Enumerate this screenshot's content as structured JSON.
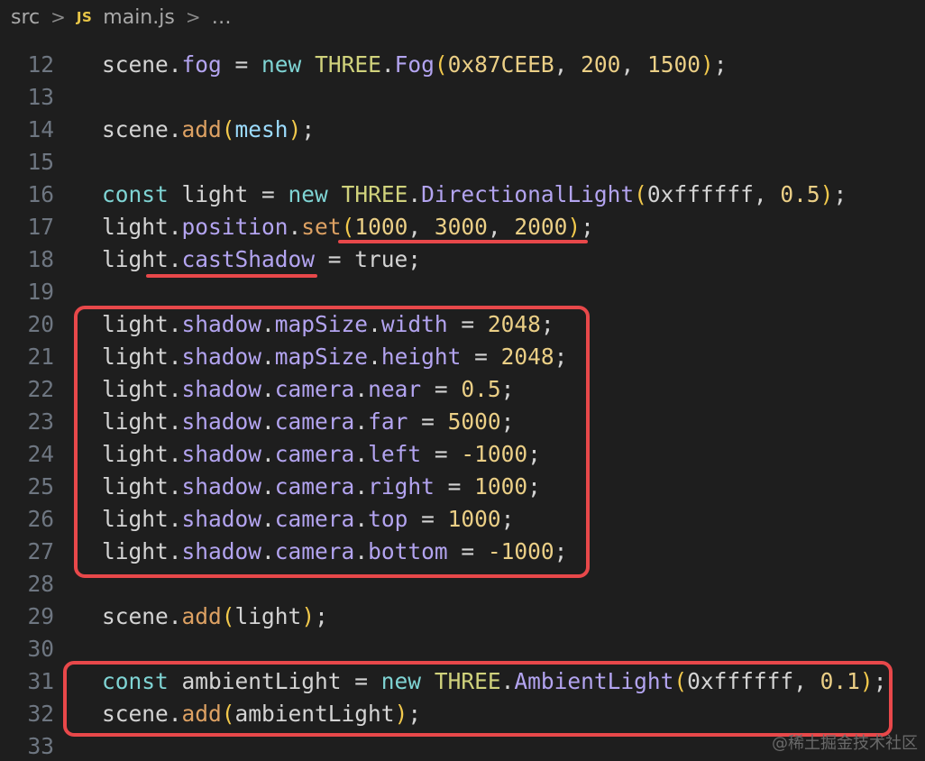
{
  "breadcrumb": {
    "folder": "src",
    "separator": ">",
    "file_icon_label": "JS",
    "file": "main.js",
    "more": "…"
  },
  "code": {
    "lines": [
      {
        "number": "12",
        "tokens": [
          {
            "t": "scene.",
            "c": "plain"
          },
          {
            "t": "fog",
            "c": "prop"
          },
          {
            "t": " = ",
            "c": "plain"
          },
          {
            "t": "new",
            "c": "kw"
          },
          {
            "t": " ",
            "c": "plain"
          },
          {
            "t": "THREE",
            "c": "class"
          },
          {
            "t": ".",
            "c": "plain"
          },
          {
            "t": "Fog",
            "c": "ctor"
          },
          {
            "t": "(",
            "c": "paren"
          },
          {
            "t": "0x87CEEB",
            "c": "num"
          },
          {
            "t": ", ",
            "c": "plain"
          },
          {
            "t": "200",
            "c": "num"
          },
          {
            "t": ", ",
            "c": "plain"
          },
          {
            "t": "1500",
            "c": "num"
          },
          {
            "t": ")",
            "c": "paren"
          },
          {
            "t": ";",
            "c": "plain"
          }
        ]
      },
      {
        "number": "13",
        "tokens": []
      },
      {
        "number": "14",
        "tokens": [
          {
            "t": "scene.",
            "c": "plain"
          },
          {
            "t": "add",
            "c": "fn"
          },
          {
            "t": "(",
            "c": "paren"
          },
          {
            "t": "mesh",
            "c": "var"
          },
          {
            "t": ")",
            "c": "paren"
          },
          {
            "t": ";",
            "c": "plain"
          }
        ]
      },
      {
        "number": "15",
        "tokens": []
      },
      {
        "number": "16",
        "tokens": [
          {
            "t": "const",
            "c": "kw"
          },
          {
            "t": " light = ",
            "c": "plain"
          },
          {
            "t": "new",
            "c": "kw"
          },
          {
            "t": " ",
            "c": "plain"
          },
          {
            "t": "THREE",
            "c": "class"
          },
          {
            "t": ".",
            "c": "plain"
          },
          {
            "t": "DirectionalLight",
            "c": "ctor"
          },
          {
            "t": "(",
            "c": "paren"
          },
          {
            "t": "0xffffff",
            "c": "plain"
          },
          {
            "t": ", ",
            "c": "plain"
          },
          {
            "t": "0.5",
            "c": "num"
          },
          {
            "t": ")",
            "c": "paren"
          },
          {
            "t": ";",
            "c": "plain"
          }
        ]
      },
      {
        "number": "17",
        "tokens": [
          {
            "t": "light.",
            "c": "plain"
          },
          {
            "t": "position",
            "c": "prop"
          },
          {
            "t": ".",
            "c": "plain"
          },
          {
            "t": "set",
            "c": "fn"
          },
          {
            "t": "(",
            "c": "paren"
          },
          {
            "t": "1000",
            "c": "num"
          },
          {
            "t": ", ",
            "c": "plain"
          },
          {
            "t": "3000",
            "c": "num"
          },
          {
            "t": ", ",
            "c": "plain"
          },
          {
            "t": "2000",
            "c": "num"
          },
          {
            "t": ")",
            "c": "paren"
          },
          {
            "t": ";",
            "c": "plain"
          }
        ]
      },
      {
        "number": "18",
        "tokens": [
          {
            "t": "light.",
            "c": "plain"
          },
          {
            "t": "castShadow",
            "c": "prop"
          },
          {
            "t": " = true;",
            "c": "plain"
          }
        ]
      },
      {
        "number": "19",
        "tokens": []
      },
      {
        "number": "20",
        "tokens": [
          {
            "t": "light.",
            "c": "plain"
          },
          {
            "t": "shadow",
            "c": "prop"
          },
          {
            "t": ".",
            "c": "plain"
          },
          {
            "t": "mapSize",
            "c": "prop"
          },
          {
            "t": ".",
            "c": "plain"
          },
          {
            "t": "width",
            "c": "prop"
          },
          {
            "t": " = ",
            "c": "plain"
          },
          {
            "t": "2048",
            "c": "num"
          },
          {
            "t": ";",
            "c": "plain"
          }
        ]
      },
      {
        "number": "21",
        "tokens": [
          {
            "t": "light.",
            "c": "plain"
          },
          {
            "t": "shadow",
            "c": "prop"
          },
          {
            "t": ".",
            "c": "plain"
          },
          {
            "t": "mapSize",
            "c": "prop"
          },
          {
            "t": ".",
            "c": "plain"
          },
          {
            "t": "height",
            "c": "prop"
          },
          {
            "t": " = ",
            "c": "plain"
          },
          {
            "t": "2048",
            "c": "num"
          },
          {
            "t": ";",
            "c": "plain"
          }
        ]
      },
      {
        "number": "22",
        "tokens": [
          {
            "t": "light.",
            "c": "plain"
          },
          {
            "t": "shadow",
            "c": "prop"
          },
          {
            "t": ".",
            "c": "plain"
          },
          {
            "t": "camera",
            "c": "prop"
          },
          {
            "t": ".",
            "c": "plain"
          },
          {
            "t": "near",
            "c": "prop"
          },
          {
            "t": " = ",
            "c": "plain"
          },
          {
            "t": "0.5",
            "c": "num"
          },
          {
            "t": ";",
            "c": "plain"
          }
        ]
      },
      {
        "number": "23",
        "tokens": [
          {
            "t": "light.",
            "c": "plain"
          },
          {
            "t": "shadow",
            "c": "prop"
          },
          {
            "t": ".",
            "c": "plain"
          },
          {
            "t": "camera",
            "c": "prop"
          },
          {
            "t": ".",
            "c": "plain"
          },
          {
            "t": "far",
            "c": "prop"
          },
          {
            "t": " = ",
            "c": "plain"
          },
          {
            "t": "5000",
            "c": "num"
          },
          {
            "t": ";",
            "c": "plain"
          }
        ]
      },
      {
        "number": "24",
        "tokens": [
          {
            "t": "light.",
            "c": "plain"
          },
          {
            "t": "shadow",
            "c": "prop"
          },
          {
            "t": ".",
            "c": "plain"
          },
          {
            "t": "camera",
            "c": "prop"
          },
          {
            "t": ".",
            "c": "plain"
          },
          {
            "t": "left",
            "c": "prop"
          },
          {
            "t": " = ",
            "c": "plain"
          },
          {
            "t": "-1000",
            "c": "num"
          },
          {
            "t": ";",
            "c": "plain"
          }
        ]
      },
      {
        "number": "25",
        "tokens": [
          {
            "t": "light.",
            "c": "plain"
          },
          {
            "t": "shadow",
            "c": "prop"
          },
          {
            "t": ".",
            "c": "plain"
          },
          {
            "t": "camera",
            "c": "prop"
          },
          {
            "t": ".",
            "c": "plain"
          },
          {
            "t": "right",
            "c": "prop"
          },
          {
            "t": " = ",
            "c": "plain"
          },
          {
            "t": "1000",
            "c": "num"
          },
          {
            "t": ";",
            "c": "plain"
          }
        ]
      },
      {
        "number": "26",
        "tokens": [
          {
            "t": "light.",
            "c": "plain"
          },
          {
            "t": "shadow",
            "c": "prop"
          },
          {
            "t": ".",
            "c": "plain"
          },
          {
            "t": "camera",
            "c": "prop"
          },
          {
            "t": ".",
            "c": "plain"
          },
          {
            "t": "top",
            "c": "prop"
          },
          {
            "t": " = ",
            "c": "plain"
          },
          {
            "t": "1000",
            "c": "num"
          },
          {
            "t": ";",
            "c": "plain"
          }
        ]
      },
      {
        "number": "27",
        "tokens": [
          {
            "t": "light.",
            "c": "plain"
          },
          {
            "t": "shadow",
            "c": "prop"
          },
          {
            "t": ".",
            "c": "plain"
          },
          {
            "t": "camera",
            "c": "prop"
          },
          {
            "t": ".",
            "c": "plain"
          },
          {
            "t": "bottom",
            "c": "prop"
          },
          {
            "t": " = ",
            "c": "plain"
          },
          {
            "t": "-1000",
            "c": "num"
          },
          {
            "t": ";",
            "c": "plain"
          }
        ]
      },
      {
        "number": "28",
        "tokens": []
      },
      {
        "number": "29",
        "tokens": [
          {
            "t": "scene.",
            "c": "plain"
          },
          {
            "t": "add",
            "c": "fn"
          },
          {
            "t": "(",
            "c": "paren"
          },
          {
            "t": "light",
            "c": "plain"
          },
          {
            "t": ")",
            "c": "paren"
          },
          {
            "t": ";",
            "c": "plain"
          }
        ]
      },
      {
        "number": "30",
        "tokens": []
      },
      {
        "number": "31",
        "tokens": [
          {
            "t": "const",
            "c": "kw"
          },
          {
            "t": " ambientLight = ",
            "c": "plain"
          },
          {
            "t": "new",
            "c": "kw"
          },
          {
            "t": " ",
            "c": "plain"
          },
          {
            "t": "THREE",
            "c": "class"
          },
          {
            "t": ".",
            "c": "plain"
          },
          {
            "t": "AmbientLight",
            "c": "ctor"
          },
          {
            "t": "(",
            "c": "paren"
          },
          {
            "t": "0xffffff",
            "c": "plain"
          },
          {
            "t": ", ",
            "c": "plain"
          },
          {
            "t": "0.1",
            "c": "num"
          },
          {
            "t": ")",
            "c": "paren"
          },
          {
            "t": ";",
            "c": "plain"
          }
        ]
      },
      {
        "number": "32",
        "tokens": [
          {
            "t": "scene.",
            "c": "plain"
          },
          {
            "t": "add",
            "c": "fn"
          },
          {
            "t": "(",
            "c": "paren"
          },
          {
            "t": "ambientLight",
            "c": "plain"
          },
          {
            "t": ")",
            "c": "paren"
          },
          {
            "t": ";",
            "c": "plain"
          }
        ]
      },
      {
        "number": "33",
        "tokens": []
      }
    ]
  },
  "colors": {
    "background": "#1e1e1e",
    "annotation": "#e8484a"
  },
  "watermark": "@稀土掘金技术社区"
}
